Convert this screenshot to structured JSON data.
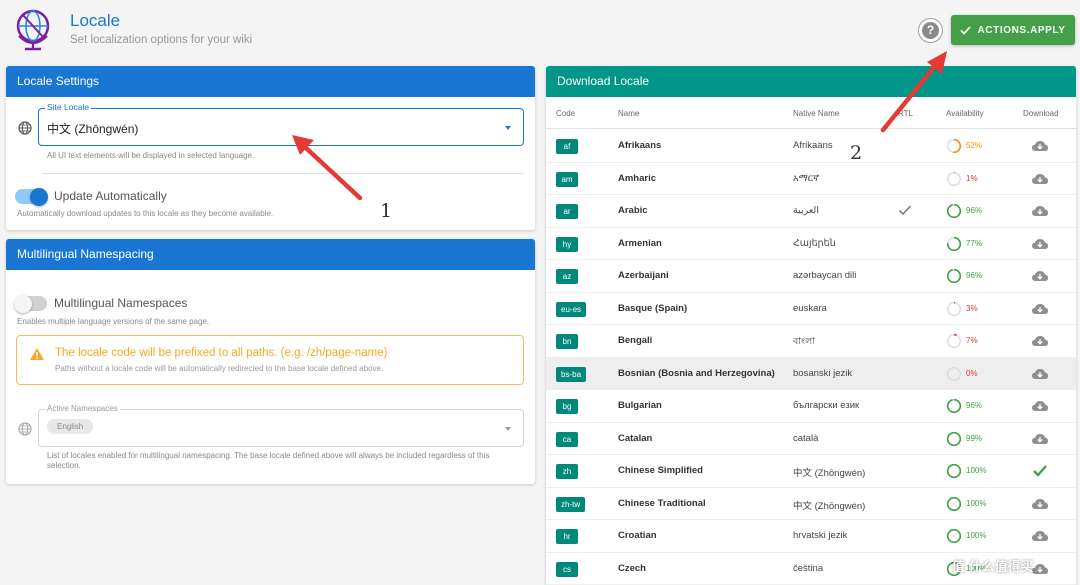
{
  "header": {
    "title": "Locale",
    "subtitle": "Set localization options for your wiki",
    "help_label": "?",
    "apply_label": "ACTIONS.APPLY"
  },
  "locale_settings": {
    "title": "Locale Settings",
    "site_locale_label": "Site Locale",
    "site_locale_value": "中文 (Zhōngwén)",
    "site_locale_hint": "All UI text elements will be displayed in selected language.",
    "update_auto_label": "Update Automatically",
    "update_auto_on": true,
    "update_auto_hint": "Automatically download updates to this locale as they become available."
  },
  "namespacing": {
    "title": "Multilingual Namespacing",
    "toggle_label": "Multilingual Namespaces",
    "toggle_on": false,
    "toggle_hint": "Enables multiple language versions of the same page.",
    "alert_title": "The locale code will be prefixed to all paths. (e.g. /zh/page-name)",
    "alert_text": "Paths without a locale code will be automatically redirected to the base locale defined above.",
    "active_label": "Active Namespaces",
    "active_chip": "English",
    "active_hint": "List of locales enabled for multilingual namespacing. The base locale defined above will always be included regardless of this selection."
  },
  "download": {
    "title": "Download Locale",
    "columns": [
      "Code",
      "Name",
      "Native Name",
      "RTL",
      "Availability",
      "Download"
    ],
    "rows": [
      {
        "code": "af",
        "name": "Afrikaans",
        "native": "Afrikaans",
        "rtl": false,
        "pct": "52%",
        "value": 52,
        "installed": false
      },
      {
        "code": "am",
        "name": "Amharic",
        "native": "አማርኛ",
        "rtl": false,
        "pct": "1%",
        "value": 1,
        "installed": false
      },
      {
        "code": "ar",
        "name": "Arabic",
        "native": "العربية",
        "rtl": true,
        "pct": "96%",
        "value": 96,
        "installed": false
      },
      {
        "code": "hy",
        "name": "Armenian",
        "native": "Հայերեն",
        "rtl": false,
        "pct": "77%",
        "value": 77,
        "installed": false
      },
      {
        "code": "az",
        "name": "Azerbaijani",
        "native": "azərbaycan dili",
        "rtl": false,
        "pct": "96%",
        "value": 96,
        "installed": false
      },
      {
        "code": "eu-es",
        "name": "Basque (Spain)",
        "native": "euskara",
        "rtl": false,
        "pct": "3%",
        "value": 3,
        "installed": false
      },
      {
        "code": "bn",
        "name": "Bengali",
        "native": "বাংলা",
        "rtl": false,
        "pct": "7%",
        "value": 7,
        "installed": false
      },
      {
        "code": "bs-ba",
        "name": "Bosnian (Bosnia and Herzegovina)",
        "native": "bosanski jezik",
        "rtl": false,
        "pct": "0%",
        "value": 0,
        "installed": false,
        "highlight": true
      },
      {
        "code": "bg",
        "name": "Bulgarian",
        "native": "български език",
        "rtl": false,
        "pct": "96%",
        "value": 96,
        "installed": false
      },
      {
        "code": "ca",
        "name": "Catalan",
        "native": "català",
        "rtl": false,
        "pct": "99%",
        "value": 99,
        "installed": false
      },
      {
        "code": "zh",
        "name": "Chinese Simplified",
        "native": "中文 (Zhōngwén)",
        "rtl": false,
        "pct": "100%",
        "value": 100,
        "installed": true
      },
      {
        "code": "zh-tw",
        "name": "Chinese Traditional",
        "native": "中文 (Zhōngwén)",
        "rtl": false,
        "pct": "100%",
        "value": 100,
        "installed": false
      },
      {
        "code": "hr",
        "name": "Croatian",
        "native": "hrvatski jezik",
        "rtl": false,
        "pct": "100%",
        "value": 100,
        "installed": false
      },
      {
        "code": "cs",
        "name": "Czech",
        "native": "čeština",
        "rtl": false,
        "pct": "100%",
        "value": 100,
        "installed": false
      }
    ]
  },
  "annotations": {
    "one": "1",
    "two": "2"
  },
  "watermark": "值 什么值得买",
  "colors": {
    "primary": "#1976d2",
    "teal": "#009688",
    "success": "#43a047",
    "warning": "#f9a825",
    "arrow": "#e53935"
  }
}
